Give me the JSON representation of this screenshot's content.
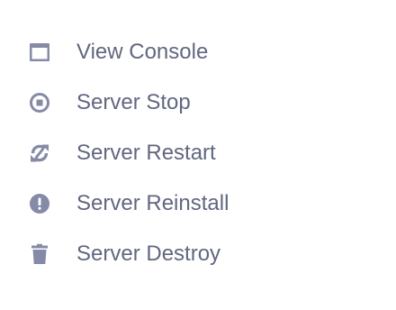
{
  "menu": {
    "icon_color": "#858aa6",
    "text_color": "#61677f",
    "items": [
      {
        "label": "View Console",
        "icon": "window-icon"
      },
      {
        "label": "Server Stop",
        "icon": "stop-circle-icon"
      },
      {
        "label": "Server Restart",
        "icon": "restart-icon"
      },
      {
        "label": "Server Reinstall",
        "icon": "alert-circle-icon"
      },
      {
        "label": "Server Destroy",
        "icon": "trash-icon"
      }
    ]
  }
}
